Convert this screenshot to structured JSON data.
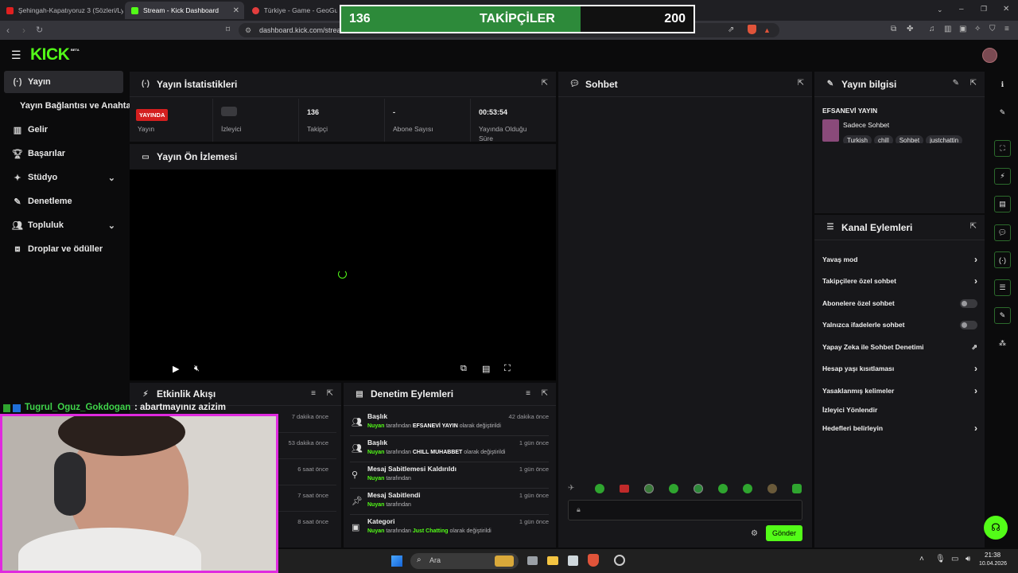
{
  "browser": {
    "tabs": [
      {
        "label": "Şehingah-Kapatıyoruz 3 (Sözleri/Lyric"
      },
      {
        "label": "Stream - Kick Dashboard"
      },
      {
        "label": "Türkiye - Game - GeoGuess"
      }
    ],
    "url": "dashboard.kick.com/strea"
  },
  "overlay": {
    "current": "136",
    "title": "TAKİPÇİLER",
    "goal": "200",
    "progress": 0.68
  },
  "app": {
    "logo": "KICK",
    "logo_badge": "BETA"
  },
  "sidebar": {
    "items": [
      {
        "label": "Yayın"
      },
      {
        "label": "Yayın Bağlantısı ve Anahtarı"
      },
      {
        "label": "Gelir"
      },
      {
        "label": "Başarılar"
      },
      {
        "label": "Stüdyo"
      },
      {
        "label": "Denetleme"
      },
      {
        "label": "Topluluk"
      },
      {
        "label": "Droplar ve ödüller"
      }
    ]
  },
  "stats": {
    "title": "Yayın İstatistikleri",
    "live_badge": "YAYINDA",
    "items": [
      {
        "value": "",
        "label": "Yayın"
      },
      {
        "value": "",
        "label": "İzleyici"
      },
      {
        "value": "136",
        "label": "Takipçi"
      },
      {
        "value": "-",
        "label": "Abone Sayısı"
      },
      {
        "value": "00:53:54",
        "label": "Yayında Olduğu Süre"
      }
    ]
  },
  "preview": {
    "title": "Yayın Ön İzlemesi"
  },
  "activity": {
    "title": "Etkinlik Akışı",
    "times": [
      "7 dakika önce",
      "53 dakika önce",
      "6 saat önce",
      "7 saat önce",
      "8 saat önce"
    ]
  },
  "chat_overlay": {
    "user": "Tugrul_Oguz_Gokdogan",
    "message": ": abartmayınız azizim"
  },
  "moderation": {
    "title": "Denetim Eylemleri",
    "items": [
      {
        "title": "Başlık",
        "time": "42 dakika önce",
        "user": "Nuyan",
        "mid": "tarafından",
        "value": "EFSANEVİ YAYIN",
        "tail": "olarak değiştirildi"
      },
      {
        "title": "Başlık",
        "time": "1 gün önce",
        "user": "Nuyan",
        "mid": "tarafından",
        "value": "CHILL MUHABBET",
        "tail": "olarak değiştirildi"
      },
      {
        "title": "Mesaj Sabitlemesi Kaldırıldı",
        "time": "1 gün önce",
        "user": "Nuyan",
        "mid": "tarafından",
        "value": "",
        "tail": ""
      },
      {
        "title": "Mesaj Sabitlendi",
        "time": "1 gün önce",
        "user": "Nuyan",
        "mid": "tarafından",
        "value": "",
        "tail": ""
      },
      {
        "title": "Kategori",
        "time": "1 gün önce",
        "user": "Nuyan",
        "mid": "tarafından",
        "value": "Just Chatting",
        "tail": "olarak değiştirildi"
      }
    ]
  },
  "chat": {
    "title": "Sohbet",
    "send": "Gönder"
  },
  "info": {
    "title": "Yayın bilgisi",
    "stream_title": "EFSANEVİ YAYIN",
    "category": "Sadece Sohbet",
    "tags": [
      "Turkish",
      "chill",
      "Sohbet",
      "justchattin"
    ]
  },
  "channel_actions": {
    "title": "Kanal Eylemleri",
    "items": [
      {
        "label": "Yavaş mod"
      },
      {
        "label": "Takipçilere özel sohbet"
      },
      {
        "label": "Abonelere özel sohbet"
      },
      {
        "label": "Yalnızca ifadelerle sohbet"
      },
      {
        "label": "Yapay Zeka ile Sohbet Denetimi"
      },
      {
        "label": "Hesap yaşı kısıtlaması"
      },
      {
        "label": "Yasaklanmış kelimeler"
      },
      {
        "label": "İzleyici Yönlendir"
      },
      {
        "label": "Hedefleri belirleyin"
      }
    ]
  },
  "taskbar": {
    "search": "Ara",
    "time": "21:38",
    "date": "10.04.2026"
  }
}
